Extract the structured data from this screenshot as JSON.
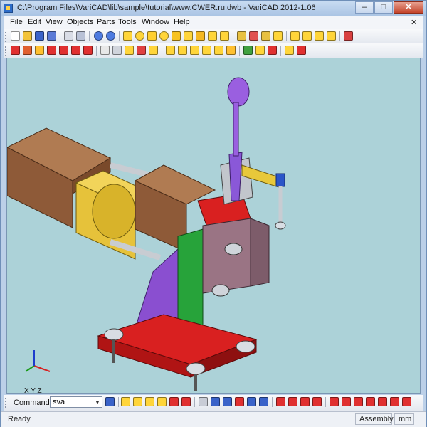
{
  "window": {
    "title": "C:\\Program Files\\VariCAD\\lib\\sample\\tutorial\\www.CWER.ru.dwb - VariCAD 2012-1.06",
    "minimize": "–",
    "maximize": "□",
    "close": "✕"
  },
  "menu": {
    "items": [
      "File",
      "Edit",
      "View",
      "Objects",
      "Parts",
      "Tools",
      "Window",
      "Help"
    ],
    "close_child": "✕"
  },
  "viewport": {
    "axis_labels": "X Y Z",
    "axis_colors": {
      "x": "#d82020",
      "y": "#1a9a1a",
      "z": "#1e3ccc"
    }
  },
  "command": {
    "label": "Command:",
    "value": "sva",
    "dropdown": "▼"
  },
  "status": {
    "left": "Ready",
    "mode": "Assembly",
    "units": "mm"
  },
  "colors": {
    "viewport_bg": "#acd2d8",
    "brown_beam": "#9a6440",
    "yellow_cyl": "#e8c83a",
    "red_base": "#d92020",
    "green_column": "#27a33a",
    "purple_brace": "#8a4fd0",
    "handle_purple": "#9a5fe0"
  }
}
